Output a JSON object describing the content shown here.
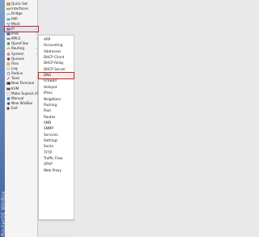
{
  "brand": {
    "strip_text": "RouterOS WinBox"
  },
  "colors": {
    "highlight_border": "#d42020",
    "brand_strip": "#4a6aa8"
  },
  "sidebar": {
    "items": [
      {
        "label": "Quick Set",
        "icon": "quick-set-icon",
        "has_submenu": false
      },
      {
        "label": "Interfaces",
        "icon": "interfaces-icon",
        "has_submenu": false
      },
      {
        "label": "Bridge",
        "icon": "bridge-icon",
        "has_submenu": false
      },
      {
        "label": "PPP",
        "icon": "ppp-icon",
        "has_submenu": false
      },
      {
        "label": "Mesh",
        "icon": "mesh-icon",
        "has_submenu": false
      },
      {
        "label": "IP",
        "icon": "ip-icon",
        "has_submenu": true,
        "selected": true
      },
      {
        "label": "IPv6",
        "icon": "ipv6-icon",
        "has_submenu": true
      },
      {
        "label": "MPLS",
        "icon": "mpls-icon",
        "has_submenu": true
      },
      {
        "label": "OpenFlow",
        "icon": "openflow-icon",
        "has_submenu": false
      },
      {
        "label": "Routing",
        "icon": "routing-icon",
        "has_submenu": true
      },
      {
        "label": "System",
        "icon": "system-icon",
        "has_submenu": true
      },
      {
        "label": "Queues",
        "icon": "queues-icon",
        "has_submenu": false
      },
      {
        "label": "Files",
        "icon": "files-icon",
        "has_submenu": false
      },
      {
        "label": "Log",
        "icon": "log-icon",
        "has_submenu": false
      },
      {
        "label": "Radius",
        "icon": "radius-icon",
        "has_submenu": false
      },
      {
        "label": "Tools",
        "icon": "tools-icon",
        "has_submenu": true
      },
      {
        "label": "New Terminal",
        "icon": "terminal-icon",
        "has_submenu": false
      },
      {
        "label": "KVM",
        "icon": "kvm-icon",
        "has_submenu": false
      },
      {
        "label": "Make Supout.rif",
        "icon": "supout-icon",
        "has_submenu": false
      },
      {
        "label": "Manual",
        "icon": "manual-icon",
        "has_submenu": false
      },
      {
        "label": "New WinBox",
        "icon": "winbox-icon",
        "has_submenu": false
      },
      {
        "label": "Exit",
        "icon": "exit-icon",
        "has_submenu": false
      }
    ]
  },
  "submenu": {
    "parent": "IP",
    "items": [
      {
        "label": "ARP"
      },
      {
        "label": "Accounting"
      },
      {
        "label": "Addresses"
      },
      {
        "label": "DHCP Client"
      },
      {
        "label": "DHCP Relay"
      },
      {
        "label": "DHCP Server"
      },
      {
        "label": "DNS",
        "selected": true
      },
      {
        "label": "Firewall"
      },
      {
        "label": "Hotspot"
      },
      {
        "label": "IPsec"
      },
      {
        "label": "Neighbors"
      },
      {
        "label": "Packing"
      },
      {
        "label": "Pool"
      },
      {
        "label": "Routes"
      },
      {
        "label": "SMB"
      },
      {
        "label": "SNMP"
      },
      {
        "label": "Services"
      },
      {
        "label": "Settings"
      },
      {
        "label": "Socks"
      },
      {
        "label": "TFTP"
      },
      {
        "label": "Traffic Flow"
      },
      {
        "label": "UPnP"
      },
      {
        "label": "Web Proxy"
      }
    ]
  }
}
